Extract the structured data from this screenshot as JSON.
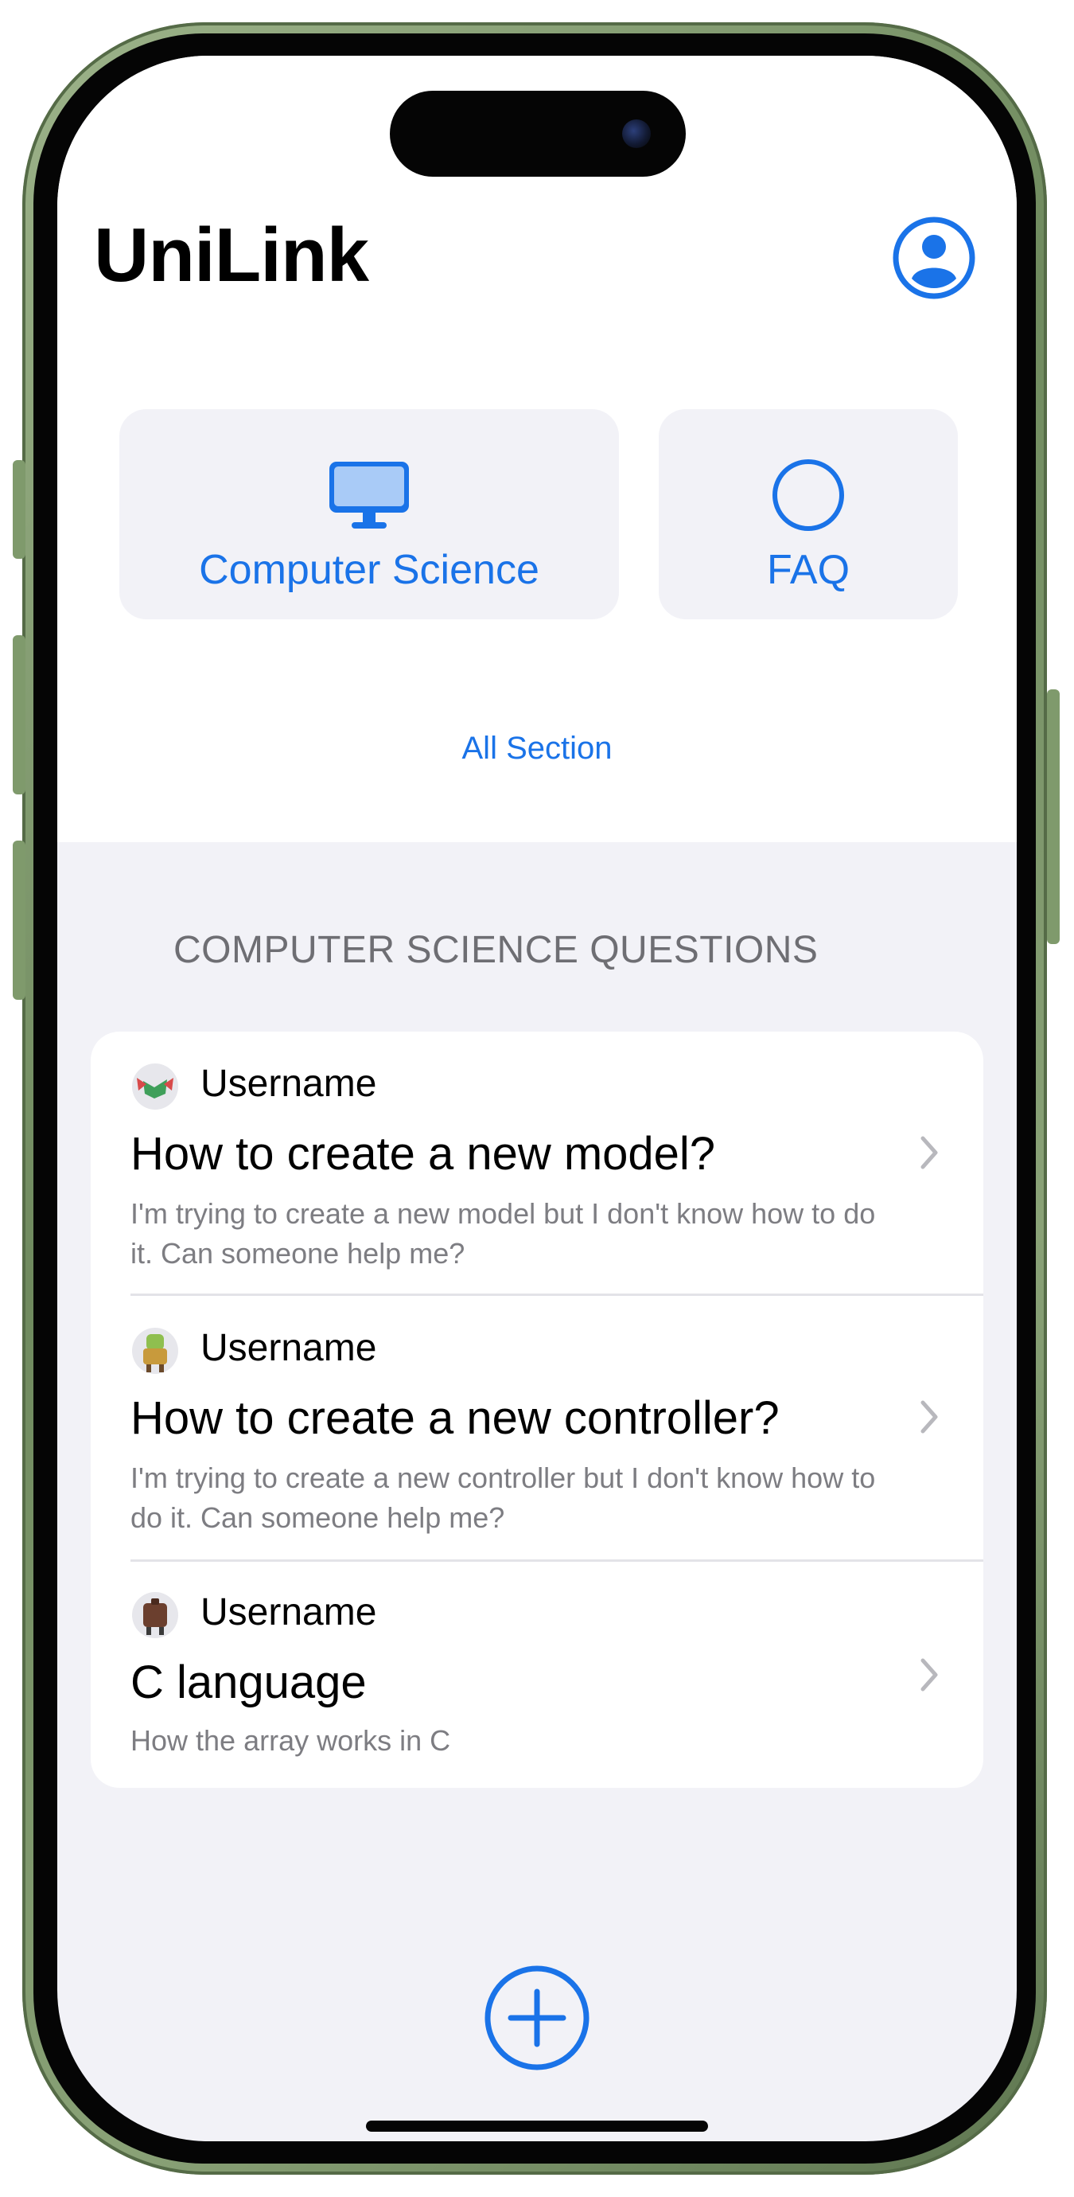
{
  "app": {
    "title": "UniLink"
  },
  "header": {
    "profile_icon": "person-circle-icon"
  },
  "categories": [
    {
      "label": "Computer Science",
      "icon": "desktop-computer-icon"
    },
    {
      "label": "FAQ",
      "icon": "circle-icon"
    }
  ],
  "all_section": {
    "label": "All Section"
  },
  "questions": {
    "header": "COMPUTER SCIENCE QUESTIONS",
    "items": [
      {
        "username": "Username",
        "avatar": "avatar-icon",
        "title": "How to create a new model?",
        "body": "I'm trying to create a new model but I don't know how to do it. Can someone help me?"
      },
      {
        "username": "Username",
        "avatar": "avatar-icon",
        "title": "How to create a new controller?",
        "body": "I'm trying to create a new controller but I don't know how to do it. Can someone help me?"
      },
      {
        "username": "Username",
        "avatar": "avatar-icon",
        "title": "C language",
        "body": "How the array works in C"
      }
    ]
  },
  "footer": {
    "add_icon": "plus-circle-icon"
  },
  "colors": {
    "accent": "#1a73e8",
    "background": "#f2f2f7",
    "card": "#ffffff",
    "secondary_text": "#7d7d82",
    "section_header": "#6e6e73"
  }
}
